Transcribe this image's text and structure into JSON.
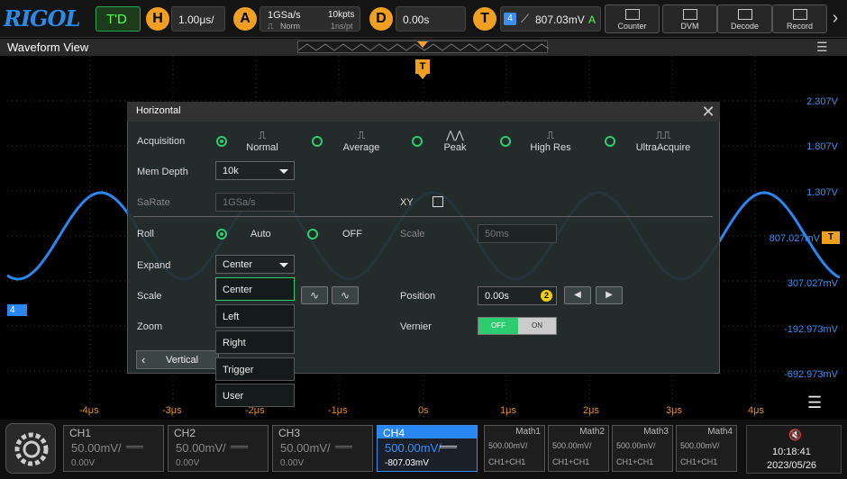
{
  "topbar": {
    "logo": "RIGOL",
    "mode": "T'D",
    "horizontal": {
      "badge": "H",
      "value": "1.00μs/"
    },
    "acquire": {
      "badge": "A",
      "rate": "1GSa/s",
      "points": "10kpts",
      "mode": "Norm",
      "per_pt": "1ns/pt"
    },
    "delay": {
      "badge": "D",
      "value": "0.00s"
    },
    "trigger": {
      "badge": "T",
      "channel": "4",
      "level": "807.03mV",
      "sweep": "A"
    },
    "tools": [
      "Counter",
      "DVM",
      "Decode",
      "Record"
    ],
    "prev_arrow": "‹",
    "next_arrow": "›"
  },
  "waveform_view": {
    "title": "Waveform View",
    "menu_icon": "☰",
    "trigger_marker": "T",
    "channel_marker": "4",
    "trig_level_marker": "T",
    "y_labels": [
      "2.307V",
      "1.807V",
      "1.307V",
      "807.027mV",
      "307.027mV",
      "-192.973mV",
      "-692.973mV"
    ],
    "x_labels": [
      "-4μs",
      "-3μs",
      "-2μs",
      "-1μs",
      "0s",
      "1μs",
      "2μs",
      "3μs",
      "4μs"
    ]
  },
  "dialog": {
    "title": "Horizontal",
    "close": "✕",
    "acquisition": {
      "label": "Acquisition",
      "options": [
        "Normal",
        "Average",
        "Peak",
        "High Res",
        "UltraAcquire"
      ],
      "selected": "Normal"
    },
    "mem_depth": {
      "label": "Mem Depth",
      "value": "10k"
    },
    "sarate": {
      "label": "SaRate",
      "value": "1GSa/s"
    },
    "xy": {
      "label": "XY"
    },
    "roll": {
      "label": "Roll",
      "options": [
        "Auto",
        "OFF"
      ],
      "selected": "Auto"
    },
    "roll_scale": {
      "label": "Scale",
      "value": "50ms"
    },
    "expand": {
      "label": "Expand",
      "value": "Center",
      "options": [
        "Center",
        "Left",
        "Right",
        "Trigger",
        "User"
      ]
    },
    "scale": {
      "label": "Scale"
    },
    "position": {
      "label": "Position",
      "value": "0.00s",
      "knob": "2"
    },
    "zoom": {
      "label": "Zoom"
    },
    "vernier": {
      "label": "Vernier",
      "off": "OFF",
      "on": "ON"
    },
    "vertical_button": "Vertical",
    "back_arrow": "‹"
  },
  "channels": [
    {
      "name": "CH1",
      "scale": "50.00mV/",
      "offset": "0.00V"
    },
    {
      "name": "CH2",
      "scale": "50.00mV/",
      "offset": "0.00V"
    },
    {
      "name": "CH3",
      "scale": "50.00mV/",
      "offset": "0.00V"
    },
    {
      "name": "CH4",
      "scale": "500.00mV/",
      "offset": "-807.03mV"
    }
  ],
  "maths": [
    {
      "name": "Math1",
      "scale": "500.00mV/",
      "src": "CH1+CH1"
    },
    {
      "name": "Math2",
      "scale": "500.00mV/",
      "src": "CH1+CH1"
    },
    {
      "name": "Math3",
      "scale": "500.00mV/",
      "src": "CH1+CH1"
    },
    {
      "name": "Math4",
      "scale": "500.00mV/",
      "src": "CH1+CH1"
    }
  ],
  "status": {
    "time": "10:18:41",
    "date": "2023/05/26",
    "mute_icon": "🔇"
  },
  "colors": {
    "ch4": "#3a8ff0",
    "trigger": "#f0a020",
    "accent": "#2ecc71"
  }
}
